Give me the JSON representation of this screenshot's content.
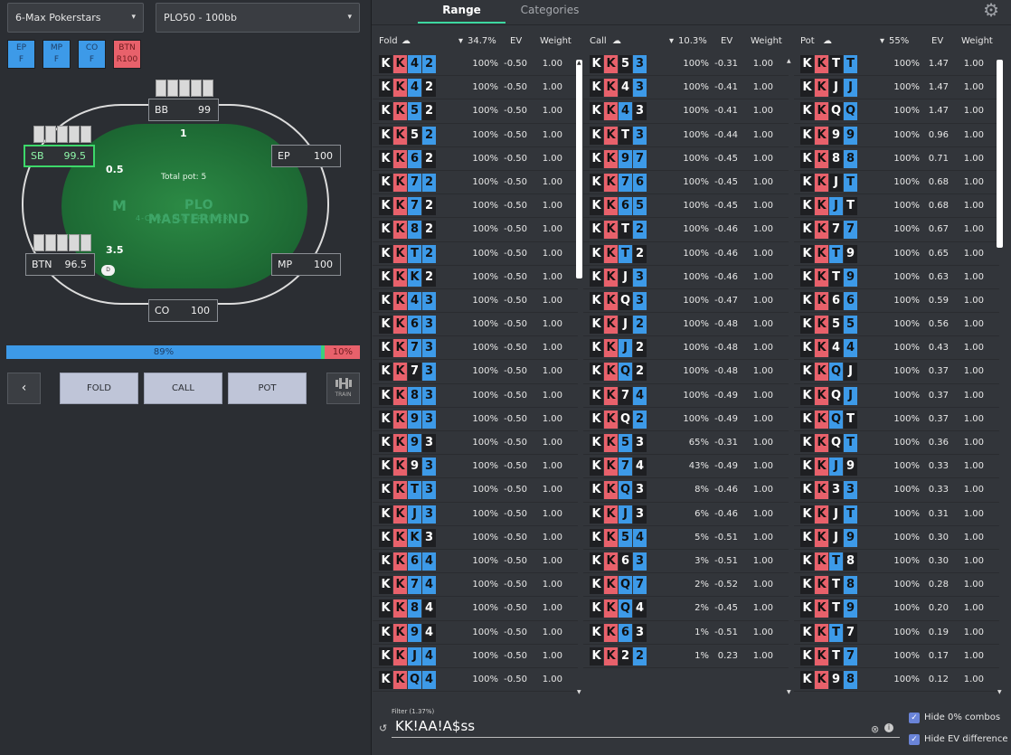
{
  "selects": {
    "site": "6-Max Pokerstars",
    "game": "PLO50 - 100bb",
    "caret": "▾"
  },
  "positions": [
    {
      "pos": "EP",
      "act": "F"
    },
    {
      "pos": "MP",
      "act": "F"
    },
    {
      "pos": "CO",
      "act": "F"
    },
    {
      "pos": "BTN",
      "act": "R100"
    }
  ],
  "table": {
    "total_pot": "Total pot: 5",
    "logo": "PLO MASTERMIND",
    "logo_sub": "4-CARD PLO TRAINER",
    "logo_mark": "M",
    "dealer": "D",
    "seats": {
      "bb": {
        "name": "BB",
        "stack": "99",
        "bet": "1"
      },
      "sb": {
        "name": "SB",
        "stack": "99.5",
        "bet": "0.5"
      },
      "ep": {
        "name": "EP",
        "stack": "100"
      },
      "btn": {
        "name": "BTN",
        "stack": "96.5",
        "bet": "3.5"
      },
      "mp": {
        "name": "MP",
        "stack": "100"
      },
      "co": {
        "name": "CO",
        "stack": "100"
      }
    }
  },
  "freq_bar": {
    "blue_label": "89%",
    "red_label": "10%",
    "blue_pct": 89,
    "green_pct": 1
  },
  "actions": {
    "back": "‹",
    "fold": "FOLD",
    "call": "CALL",
    "pot": "POT",
    "train": "TRAIN"
  },
  "tabs": {
    "range": "Range",
    "categories": "Categories"
  },
  "gear": "⚙",
  "cloud": "☁",
  "sort": "▾",
  "columns": [
    {
      "title": "Fold",
      "pct": "34.7%",
      "ev": "EV",
      "weight": "Weight",
      "rows": [
        {
          "cards": [
            "K:k",
            "K:r",
            "4:b",
            "2:b"
          ],
          "pct": "100%",
          "ev": "-0.50",
          "w": "1.00"
        },
        {
          "cards": [
            "K:k",
            "K:r",
            "4:b",
            "2:k"
          ],
          "pct": "100%",
          "ev": "-0.50",
          "w": "1.00"
        },
        {
          "cards": [
            "K:k",
            "K:r",
            "5:b",
            "2:k"
          ],
          "pct": "100%",
          "ev": "-0.50",
          "w": "1.00"
        },
        {
          "cards": [
            "K:k",
            "K:r",
            "5:k",
            "2:b"
          ],
          "pct": "100%",
          "ev": "-0.50",
          "w": "1.00"
        },
        {
          "cards": [
            "K:k",
            "K:r",
            "6:b",
            "2:k"
          ],
          "pct": "100%",
          "ev": "-0.50",
          "w": "1.00"
        },
        {
          "cards": [
            "K:k",
            "K:r",
            "7:b",
            "2:b"
          ],
          "pct": "100%",
          "ev": "-0.50",
          "w": "1.00"
        },
        {
          "cards": [
            "K:k",
            "K:r",
            "7:b",
            "2:k"
          ],
          "pct": "100%",
          "ev": "-0.50",
          "w": "1.00"
        },
        {
          "cards": [
            "K:k",
            "K:r",
            "8:b",
            "2:k"
          ],
          "pct": "100%",
          "ev": "-0.50",
          "w": "1.00"
        },
        {
          "cards": [
            "K:k",
            "K:r",
            "T:b",
            "2:b"
          ],
          "pct": "100%",
          "ev": "-0.50",
          "w": "1.00"
        },
        {
          "cards": [
            "K:k",
            "K:r",
            "K:b",
            "2:k"
          ],
          "pct": "100%",
          "ev": "-0.50",
          "w": "1.00"
        },
        {
          "cards": [
            "K:k",
            "K:r",
            "4:b",
            "3:b"
          ],
          "pct": "100%",
          "ev": "-0.50",
          "w": "1.00"
        },
        {
          "cards": [
            "K:k",
            "K:r",
            "6:b",
            "3:b"
          ],
          "pct": "100%",
          "ev": "-0.50",
          "w": "1.00"
        },
        {
          "cards": [
            "K:k",
            "K:r",
            "7:b",
            "3:b"
          ],
          "pct": "100%",
          "ev": "-0.50",
          "w": "1.00"
        },
        {
          "cards": [
            "K:k",
            "K:r",
            "7:k",
            "3:b"
          ],
          "pct": "100%",
          "ev": "-0.50",
          "w": "1.00"
        },
        {
          "cards": [
            "K:k",
            "K:r",
            "8:b",
            "3:b"
          ],
          "pct": "100%",
          "ev": "-0.50",
          "w": "1.00"
        },
        {
          "cards": [
            "K:k",
            "K:r",
            "9:b",
            "3:b"
          ],
          "pct": "100%",
          "ev": "-0.50",
          "w": "1.00"
        },
        {
          "cards": [
            "K:k",
            "K:r",
            "9:b",
            "3:k"
          ],
          "pct": "100%",
          "ev": "-0.50",
          "w": "1.00"
        },
        {
          "cards": [
            "K:k",
            "K:r",
            "9:k",
            "3:b"
          ],
          "pct": "100%",
          "ev": "-0.50",
          "w": "1.00"
        },
        {
          "cards": [
            "K:k",
            "K:r",
            "T:b",
            "3:b"
          ],
          "pct": "100%",
          "ev": "-0.50",
          "w": "1.00"
        },
        {
          "cards": [
            "K:k",
            "K:r",
            "J:b",
            "3:b"
          ],
          "pct": "100%",
          "ev": "-0.50",
          "w": "1.00"
        },
        {
          "cards": [
            "K:k",
            "K:r",
            "K:b",
            "3:k"
          ],
          "pct": "100%",
          "ev": "-0.50",
          "w": "1.00"
        },
        {
          "cards": [
            "K:k",
            "K:r",
            "6:b",
            "4:b"
          ],
          "pct": "100%",
          "ev": "-0.50",
          "w": "1.00"
        },
        {
          "cards": [
            "K:k",
            "K:r",
            "7:b",
            "4:b"
          ],
          "pct": "100%",
          "ev": "-0.50",
          "w": "1.00"
        },
        {
          "cards": [
            "K:k",
            "K:r",
            "8:b",
            "4:k"
          ],
          "pct": "100%",
          "ev": "-0.50",
          "w": "1.00"
        },
        {
          "cards": [
            "K:k",
            "K:r",
            "9:b",
            "4:k"
          ],
          "pct": "100%",
          "ev": "-0.50",
          "w": "1.00"
        },
        {
          "cards": [
            "K:k",
            "K:r",
            "J:b",
            "4:b"
          ],
          "pct": "100%",
          "ev": "-0.50",
          "w": "1.00"
        },
        {
          "cards": [
            "K:k",
            "K:r",
            "Q:b",
            "4:b"
          ],
          "pct": "100%",
          "ev": "-0.50",
          "w": "1.00"
        }
      ]
    },
    {
      "title": "Call",
      "pct": "10.3%",
      "ev": "EV",
      "weight": "Weight",
      "rows": [
        {
          "cards": [
            "K:k",
            "K:r",
            "5:k",
            "3:b"
          ],
          "pct": "100%",
          "ev": "-0.31",
          "w": "1.00"
        },
        {
          "cards": [
            "K:k",
            "K:r",
            "4:k",
            "3:b"
          ],
          "pct": "100%",
          "ev": "-0.41",
          "w": "1.00"
        },
        {
          "cards": [
            "K:k",
            "K:r",
            "4:b",
            "3:k"
          ],
          "pct": "100%",
          "ev": "-0.41",
          "w": "1.00"
        },
        {
          "cards": [
            "K:k",
            "K:r",
            "T:k",
            "3:b"
          ],
          "pct": "100%",
          "ev": "-0.44",
          "w": "1.00"
        },
        {
          "cards": [
            "K:k",
            "K:r",
            "9:b",
            "7:b"
          ],
          "pct": "100%",
          "ev": "-0.45",
          "w": "1.00"
        },
        {
          "cards": [
            "K:k",
            "K:r",
            "7:b",
            "6:b"
          ],
          "pct": "100%",
          "ev": "-0.45",
          "w": "1.00"
        },
        {
          "cards": [
            "K:k",
            "K:r",
            "6:b",
            "5:b"
          ],
          "pct": "100%",
          "ev": "-0.45",
          "w": "1.00"
        },
        {
          "cards": [
            "K:k",
            "K:r",
            "T:k",
            "2:b"
          ],
          "pct": "100%",
          "ev": "-0.46",
          "w": "1.00"
        },
        {
          "cards": [
            "K:k",
            "K:r",
            "T:b",
            "2:k"
          ],
          "pct": "100%",
          "ev": "-0.46",
          "w": "1.00"
        },
        {
          "cards": [
            "K:k",
            "K:r",
            "J:k",
            "3:b"
          ],
          "pct": "100%",
          "ev": "-0.46",
          "w": "1.00"
        },
        {
          "cards": [
            "K:k",
            "K:r",
            "Q:k",
            "3:b"
          ],
          "pct": "100%",
          "ev": "-0.47",
          "w": "1.00"
        },
        {
          "cards": [
            "K:k",
            "K:r",
            "J:k",
            "2:b"
          ],
          "pct": "100%",
          "ev": "-0.48",
          "w": "1.00"
        },
        {
          "cards": [
            "K:k",
            "K:r",
            "J:b",
            "2:k"
          ],
          "pct": "100%",
          "ev": "-0.48",
          "w": "1.00"
        },
        {
          "cards": [
            "K:k",
            "K:r",
            "Q:b",
            "2:k"
          ],
          "pct": "100%",
          "ev": "-0.48",
          "w": "1.00"
        },
        {
          "cards": [
            "K:k",
            "K:r",
            "7:k",
            "4:b"
          ],
          "pct": "100%",
          "ev": "-0.49",
          "w": "1.00"
        },
        {
          "cards": [
            "K:k",
            "K:r",
            "Q:k",
            "2:b"
          ],
          "pct": "100%",
          "ev": "-0.49",
          "w": "1.00"
        },
        {
          "cards": [
            "K:k",
            "K:r",
            "5:b",
            "3:k"
          ],
          "pct": "65%",
          "ev": "-0.31",
          "w": "1.00"
        },
        {
          "cards": [
            "K:k",
            "K:r",
            "7:b",
            "4:k"
          ],
          "pct": "43%",
          "ev": "-0.49",
          "w": "1.00"
        },
        {
          "cards": [
            "K:k",
            "K:r",
            "Q:b",
            "3:k"
          ],
          "pct": "8%",
          "ev": "-0.46",
          "w": "1.00"
        },
        {
          "cards": [
            "K:k",
            "K:r",
            "J:b",
            "3:k"
          ],
          "pct": "6%",
          "ev": "-0.46",
          "w": "1.00"
        },
        {
          "cards": [
            "K:k",
            "K:r",
            "5:b",
            "4:b"
          ],
          "pct": "5%",
          "ev": "-0.51",
          "w": "1.00"
        },
        {
          "cards": [
            "K:k",
            "K:r",
            "6:k",
            "3:b"
          ],
          "pct": "3%",
          "ev": "-0.51",
          "w": "1.00"
        },
        {
          "cards": [
            "K:k",
            "K:r",
            "Q:b",
            "7:b"
          ],
          "pct": "2%",
          "ev": "-0.52",
          "w": "1.00"
        },
        {
          "cards": [
            "K:k",
            "K:r",
            "Q:b",
            "4:k"
          ],
          "pct": "2%",
          "ev": "-0.45",
          "w": "1.00"
        },
        {
          "cards": [
            "K:k",
            "K:r",
            "6:b",
            "3:k"
          ],
          "pct": "1%",
          "ev": "-0.51",
          "w": "1.00"
        },
        {
          "cards": [
            "K:k",
            "K:r",
            "2:k",
            "2:b"
          ],
          "pct": "1%",
          "ev": "0.23",
          "w": "1.00"
        }
      ]
    },
    {
      "title": "Pot",
      "pct": "55%",
      "ev": "EV",
      "weight": "Weight",
      "rows": [
        {
          "cards": [
            "K:k",
            "K:r",
            "T:k",
            "T:b"
          ],
          "pct": "100%",
          "ev": "1.47",
          "w": "1.00"
        },
        {
          "cards": [
            "K:k",
            "K:r",
            "J:k",
            "J:b"
          ],
          "pct": "100%",
          "ev": "1.47",
          "w": "1.00"
        },
        {
          "cards": [
            "K:k",
            "K:r",
            "Q:k",
            "Q:b"
          ],
          "pct": "100%",
          "ev": "1.47",
          "w": "1.00"
        },
        {
          "cards": [
            "K:k",
            "K:r",
            "9:k",
            "9:b"
          ],
          "pct": "100%",
          "ev": "0.96",
          "w": "1.00"
        },
        {
          "cards": [
            "K:k",
            "K:r",
            "8:k",
            "8:b"
          ],
          "pct": "100%",
          "ev": "0.71",
          "w": "1.00"
        },
        {
          "cards": [
            "K:k",
            "K:r",
            "J:k",
            "T:b"
          ],
          "pct": "100%",
          "ev": "0.68",
          "w": "1.00"
        },
        {
          "cards": [
            "K:k",
            "K:r",
            "J:b",
            "T:k"
          ],
          "pct": "100%",
          "ev": "0.68",
          "w": "1.00"
        },
        {
          "cards": [
            "K:k",
            "K:r",
            "7:k",
            "7:b"
          ],
          "pct": "100%",
          "ev": "0.67",
          "w": "1.00"
        },
        {
          "cards": [
            "K:k",
            "K:r",
            "T:b",
            "9:k"
          ],
          "pct": "100%",
          "ev": "0.65",
          "w": "1.00"
        },
        {
          "cards": [
            "K:k",
            "K:r",
            "T:k",
            "9:b"
          ],
          "pct": "100%",
          "ev": "0.63",
          "w": "1.00"
        },
        {
          "cards": [
            "K:k",
            "K:r",
            "6:k",
            "6:b"
          ],
          "pct": "100%",
          "ev": "0.59",
          "w": "1.00"
        },
        {
          "cards": [
            "K:k",
            "K:r",
            "5:k",
            "5:b"
          ],
          "pct": "100%",
          "ev": "0.56",
          "w": "1.00"
        },
        {
          "cards": [
            "K:k",
            "K:r",
            "4:k",
            "4:b"
          ],
          "pct": "100%",
          "ev": "0.43",
          "w": "1.00"
        },
        {
          "cards": [
            "K:k",
            "K:r",
            "Q:b",
            "J:k"
          ],
          "pct": "100%",
          "ev": "0.37",
          "w": "1.00"
        },
        {
          "cards": [
            "K:k",
            "K:r",
            "Q:k",
            "J:b"
          ],
          "pct": "100%",
          "ev": "0.37",
          "w": "1.00"
        },
        {
          "cards": [
            "K:k",
            "K:r",
            "Q:b",
            "T:k"
          ],
          "pct": "100%",
          "ev": "0.37",
          "w": "1.00"
        },
        {
          "cards": [
            "K:k",
            "K:r",
            "Q:k",
            "T:b"
          ],
          "pct": "100%",
          "ev": "0.36",
          "w": "1.00"
        },
        {
          "cards": [
            "K:k",
            "K:r",
            "J:b",
            "9:k"
          ],
          "pct": "100%",
          "ev": "0.33",
          "w": "1.00"
        },
        {
          "cards": [
            "K:k",
            "K:r",
            "3:k",
            "3:b"
          ],
          "pct": "100%",
          "ev": "0.33",
          "w": "1.00"
        },
        {
          "cards": [
            "K:k",
            "K:r",
            "J:k",
            "T:b"
          ],
          "pct": "100%",
          "ev": "0.31",
          "w": "1.00"
        },
        {
          "cards": [
            "K:k",
            "K:r",
            "J:k",
            "9:b"
          ],
          "pct": "100%",
          "ev": "0.30",
          "w": "1.00"
        },
        {
          "cards": [
            "K:k",
            "K:r",
            "T:b",
            "8:k"
          ],
          "pct": "100%",
          "ev": "0.30",
          "w": "1.00"
        },
        {
          "cards": [
            "K:k",
            "K:r",
            "T:k",
            "8:b"
          ],
          "pct": "100%",
          "ev": "0.28",
          "w": "1.00"
        },
        {
          "cards": [
            "K:k",
            "K:r",
            "T:k",
            "9:b"
          ],
          "pct": "100%",
          "ev": "0.20",
          "w": "1.00"
        },
        {
          "cards": [
            "K:k",
            "K:r",
            "T:b",
            "7:k"
          ],
          "pct": "100%",
          "ev": "0.19",
          "w": "1.00"
        },
        {
          "cards": [
            "K:k",
            "K:r",
            "T:k",
            "7:b"
          ],
          "pct": "100%",
          "ev": "0.17",
          "w": "1.00"
        },
        {
          "cards": [
            "K:k",
            "K:r",
            "9:k",
            "8:b"
          ],
          "pct": "100%",
          "ev": "0.12",
          "w": "1.00"
        }
      ]
    }
  ],
  "filter": {
    "label": "Filter (1.37%)",
    "value": "KK!AA!A$ss",
    "history_icon": "↺",
    "clear_icon": "⊗",
    "info_icon": "i"
  },
  "options": {
    "hide_zero": "Hide 0% combos",
    "hide_ev": "Hide EV difference",
    "check": "✓"
  }
}
